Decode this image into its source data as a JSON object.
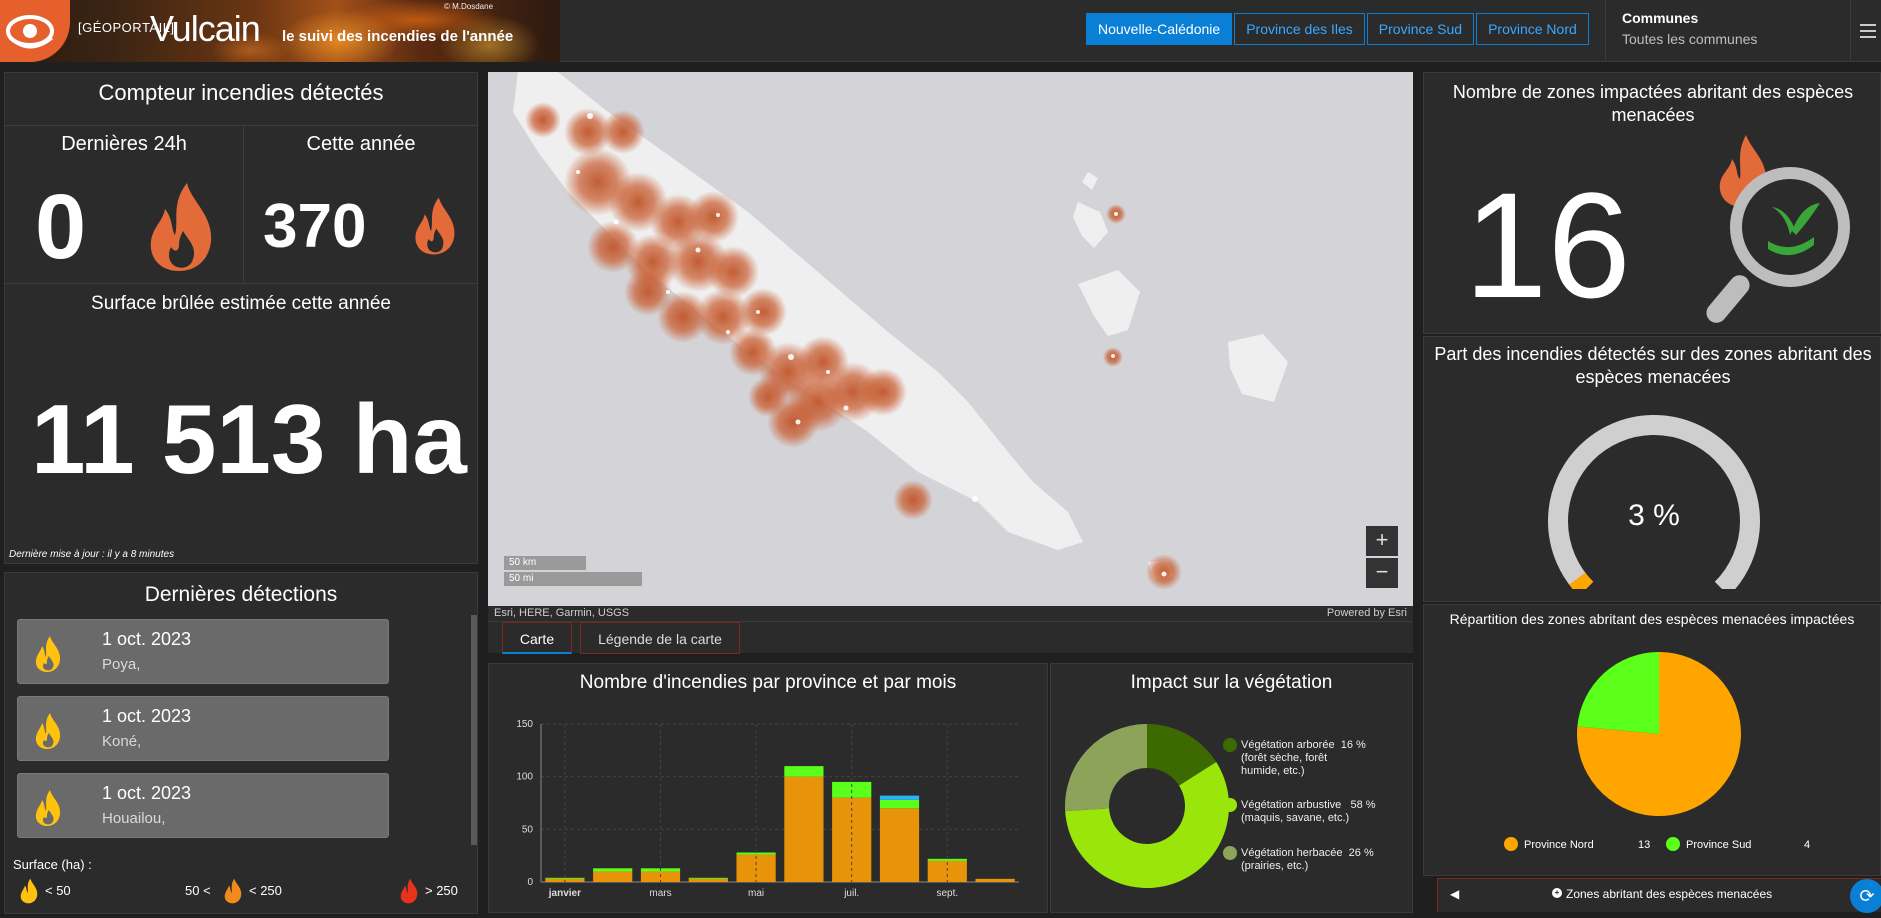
{
  "header": {
    "brand_tag": "[GÉOPORTAIL]",
    "brand_name": "Vulcain",
    "brand_subtitle": "le suivi des incendies de l'année",
    "photo_credit": "© M.Dosdane",
    "nav": [
      "Nouvelle-Calédonie",
      "Province des Iles",
      "Province Sud",
      "Province Nord"
    ],
    "communes_title": "Communes",
    "communes_value": "Toutes les communes"
  },
  "counter": {
    "title": "Compteur incendies détectés",
    "last24_label": "Dernières 24h",
    "last24_value": "0",
    "year_label": "Cette année",
    "year_value": "370",
    "surface_label": "Surface brûlée estimée cette année",
    "surface_value": "11 513 ha",
    "updated": "Dernière mise à jour : il y a 8 minutes"
  },
  "detections": {
    "title": "Dernières détections",
    "items": [
      {
        "date": "1 oct. 2023",
        "place": "Poya,"
      },
      {
        "date": "1 oct. 2023",
        "place": "Koné,"
      },
      {
        "date": "1 oct. 2023",
        "place": "Houailou,"
      }
    ],
    "legend_title": "Surface (ha) :",
    "legend_small": "< 50",
    "legend_mid_left": "50 <",
    "legend_mid_right": "< 250",
    "legend_large": "> 250"
  },
  "map": {
    "scale_km": "50 km",
    "scale_mi": "50 mi",
    "attribution": "Esri, HERE, Garmin, USGS",
    "powered": "Powered by Esri",
    "zoom_in": "+",
    "zoom_out": "−",
    "tabs": [
      "Carte",
      "Légende de la carte"
    ]
  },
  "species": {
    "zones_title": "Nombre de zones impactées abritant des espèces menacées",
    "zones_value": "16",
    "gauge_title": "Part des incendies détectés sur des zones abritant des espèces menacées",
    "gauge_value": "3 %",
    "gauge_fraction": 0.03,
    "pie_title": "Répartition des zones abritant des espèces menacées impactées",
    "pie_legend": [
      {
        "name": "Province Nord",
        "value": "13",
        "color": "#ffa500"
      },
      {
        "name": "Province Sud",
        "value": "4",
        "color": "#5aff1a"
      }
    ],
    "footer": "Zones abritant des espèces menacées"
  },
  "bar_chart_title": "Nombre d'incendies par province et par mois",
  "veg_title": "Impact sur la végétation",
  "veg_legend": [
    {
      "label": "Végétation arborée",
      "pct": "16 %",
      "sub": "(forêt sèche, forêt",
      "sub2": "humide, etc.)"
    },
    {
      "label": "Végétation arbustive",
      "pct": "58 %",
      "sub": "(maquis, savane, etc.)",
      "sub2": ""
    },
    {
      "label": "Végétation herbacée",
      "pct": "26 %",
      "sub": "(prairies, etc.)",
      "sub2": ""
    }
  ],
  "chart_data": [
    {
      "type": "bar",
      "title": "Nombre d'incendies par province et par mois",
      "x_tick_labels": [
        "janvier",
        "mars",
        "mai",
        "juil.",
        "sept."
      ],
      "categories": [
        "janv",
        "févr",
        "mars",
        "avr",
        "mai",
        "juin",
        "juil",
        "août",
        "sept",
        "oct"
      ],
      "series": [
        {
          "color": "#e8940a",
          "values": [
            3,
            10,
            10,
            3,
            26,
            100,
            80,
            70,
            20,
            3
          ]
        },
        {
          "color": "#5aff1a",
          "values": [
            1,
            3,
            3,
            1,
            2,
            10,
            15,
            8,
            2,
            0
          ]
        },
        {
          "color": "#29b6f6",
          "values": [
            0,
            0,
            0,
            0,
            0,
            0,
            0,
            4,
            0,
            0
          ]
        }
      ],
      "ylim": [
        0,
        150
      ],
      "yticks": [
        0,
        50,
        100,
        150
      ]
    },
    {
      "type": "pie",
      "title": "Impact sur la végétation",
      "labels": [
        "Végétation arborée",
        "Végétation arbustive",
        "Végétation herbacée"
      ],
      "values": [
        16,
        58,
        26
      ],
      "colors": [
        "#3d6a00",
        "#9be60a",
        "#8da35a"
      ]
    },
    {
      "type": "pie",
      "title": "Répartition des zones abritant des espèces menacées impactées",
      "labels": [
        "Province Nord",
        "Province Sud"
      ],
      "values": [
        13,
        4
      ],
      "colors": [
        "#ffa500",
        "#5aff1a"
      ]
    }
  ]
}
